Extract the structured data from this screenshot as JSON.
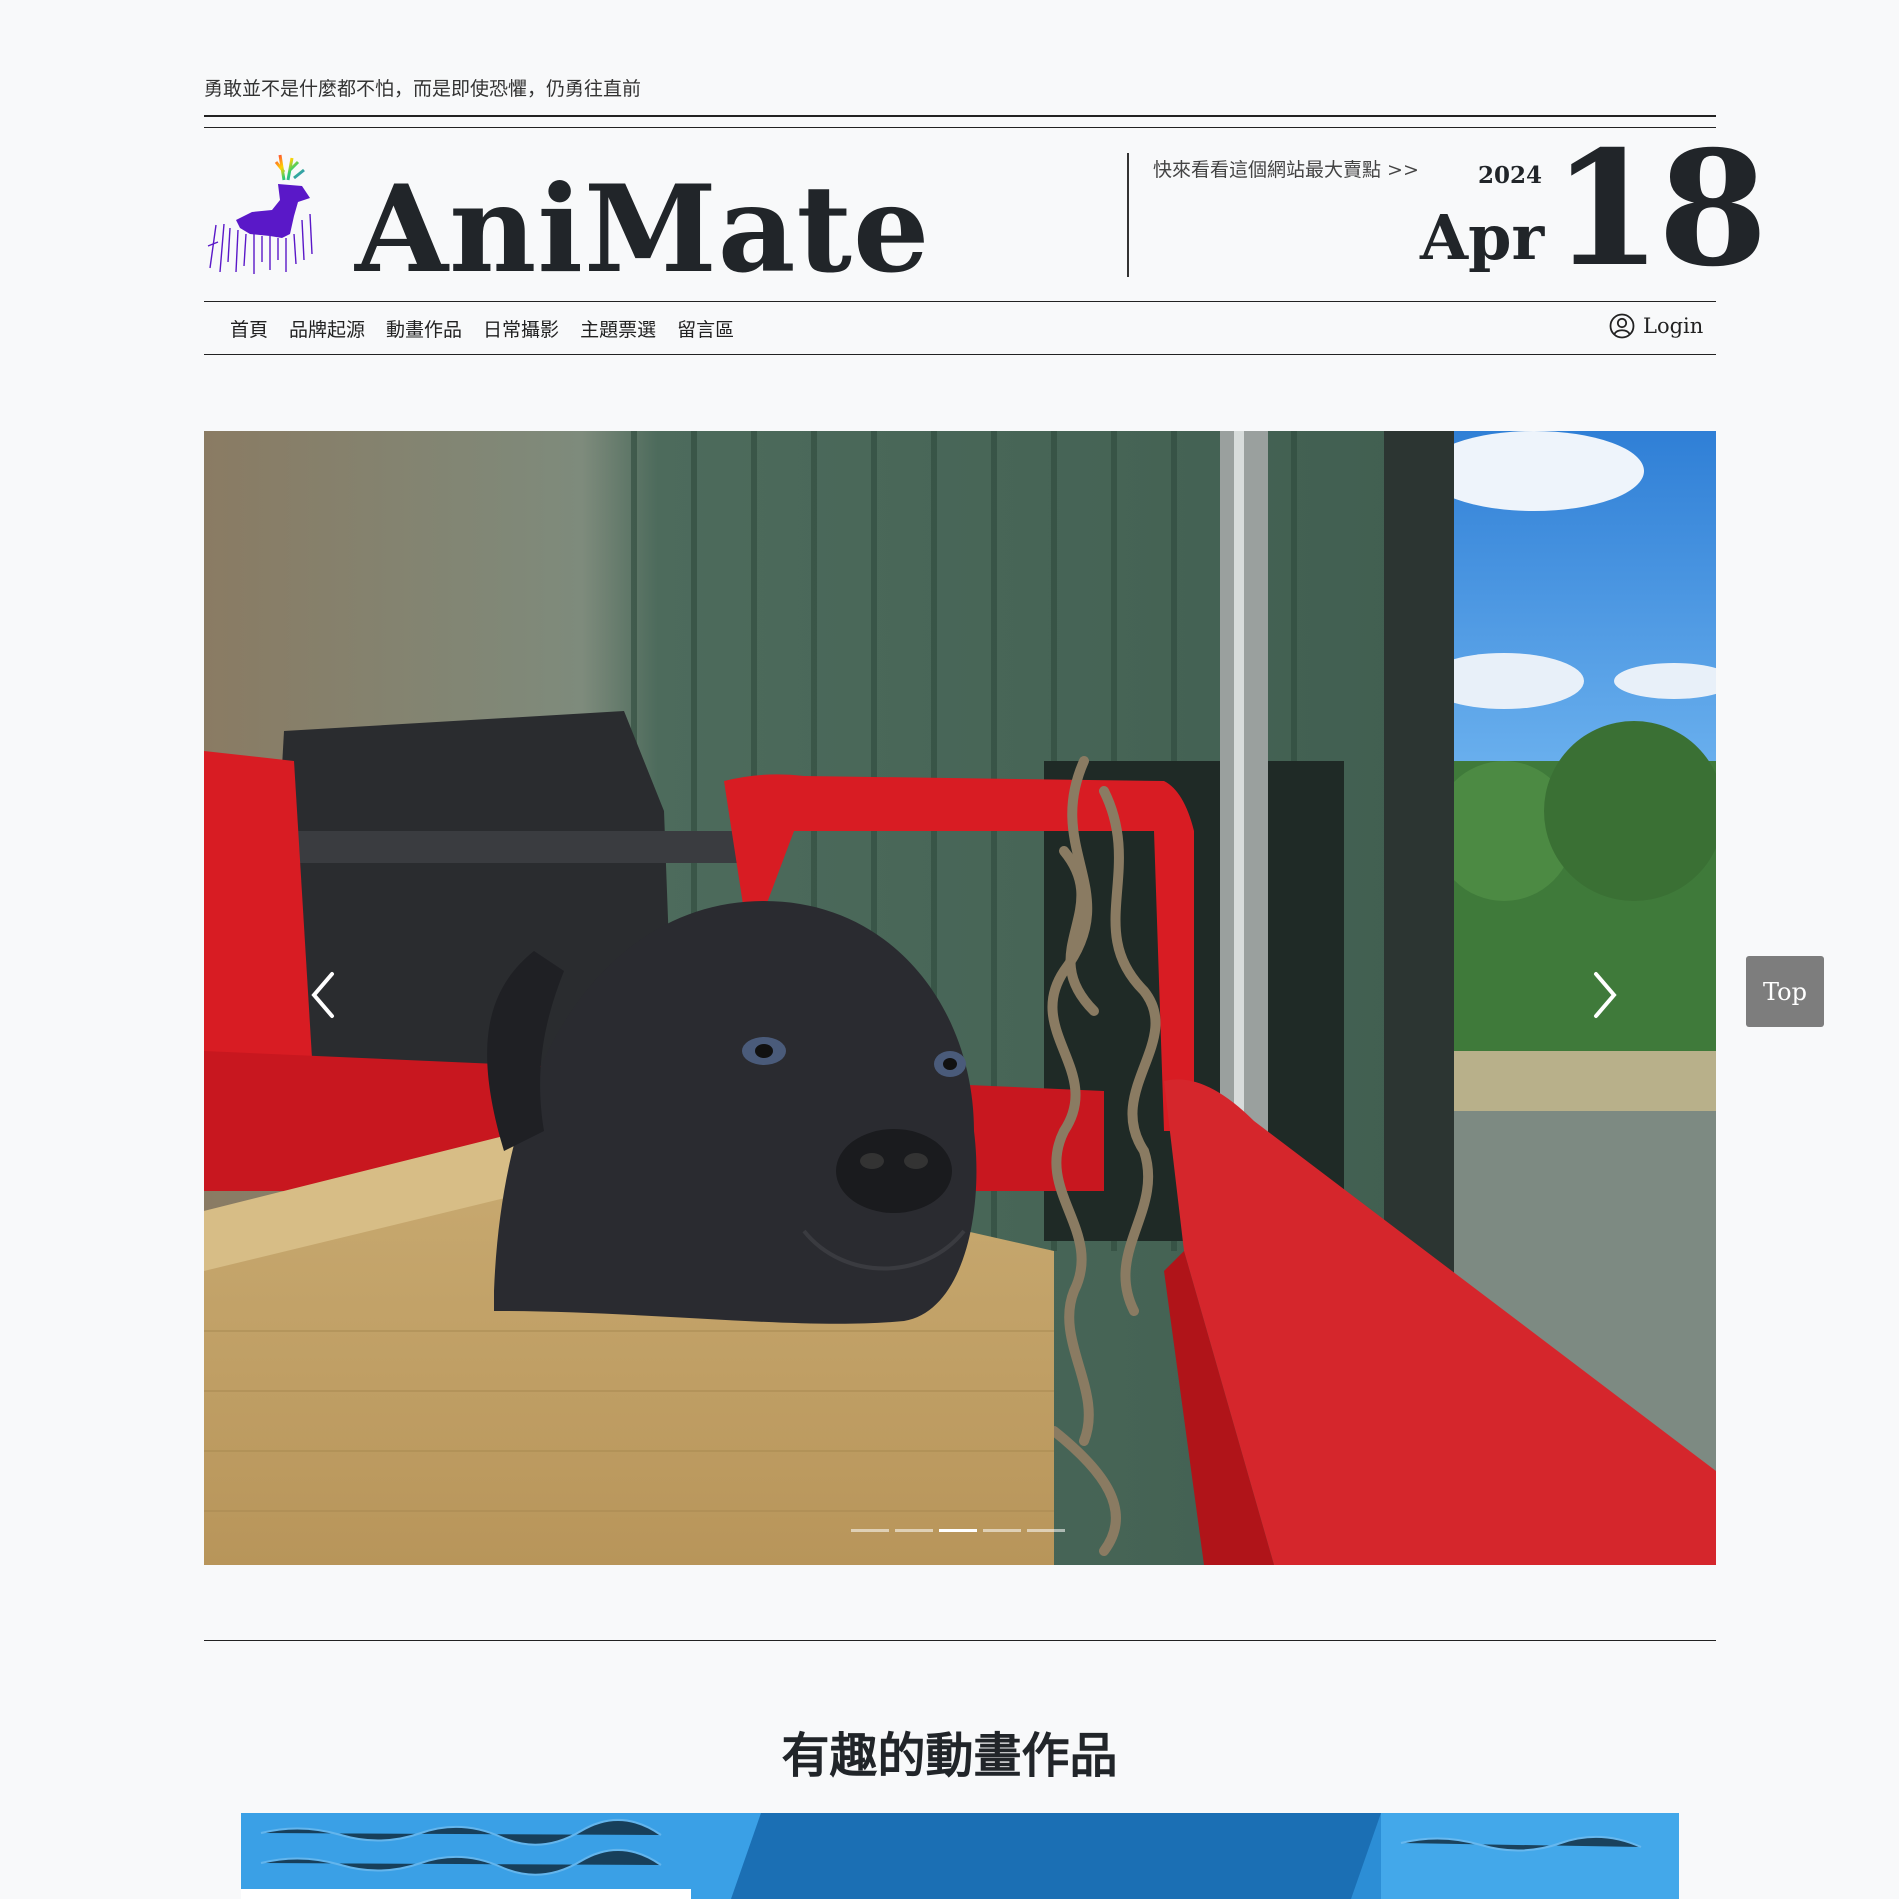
{
  "header": {
    "motto": "勇敢並不是什麼都不怕，而是即使恐懼，仍勇往直前",
    "brand": "AniMate",
    "promo": "快來看看這個網站最大賣點 >>",
    "date": {
      "year": "2024",
      "month": "Apr",
      "day": "18"
    }
  },
  "nav": {
    "items": [
      "首頁",
      "品牌起源",
      "動畫作品",
      "日常攝影",
      "主題票選",
      "留言區"
    ],
    "login_label": "Login"
  },
  "carousel": {
    "slide_count": 5,
    "active_index": 2
  },
  "top_button": {
    "label": "Top"
  },
  "section": {
    "title": "有趣的動畫作品"
  },
  "icons": {
    "logo": "deer-logo-icon",
    "user": "user-circle-icon",
    "prev": "chevron-left-icon",
    "next": "chevron-right-icon"
  }
}
